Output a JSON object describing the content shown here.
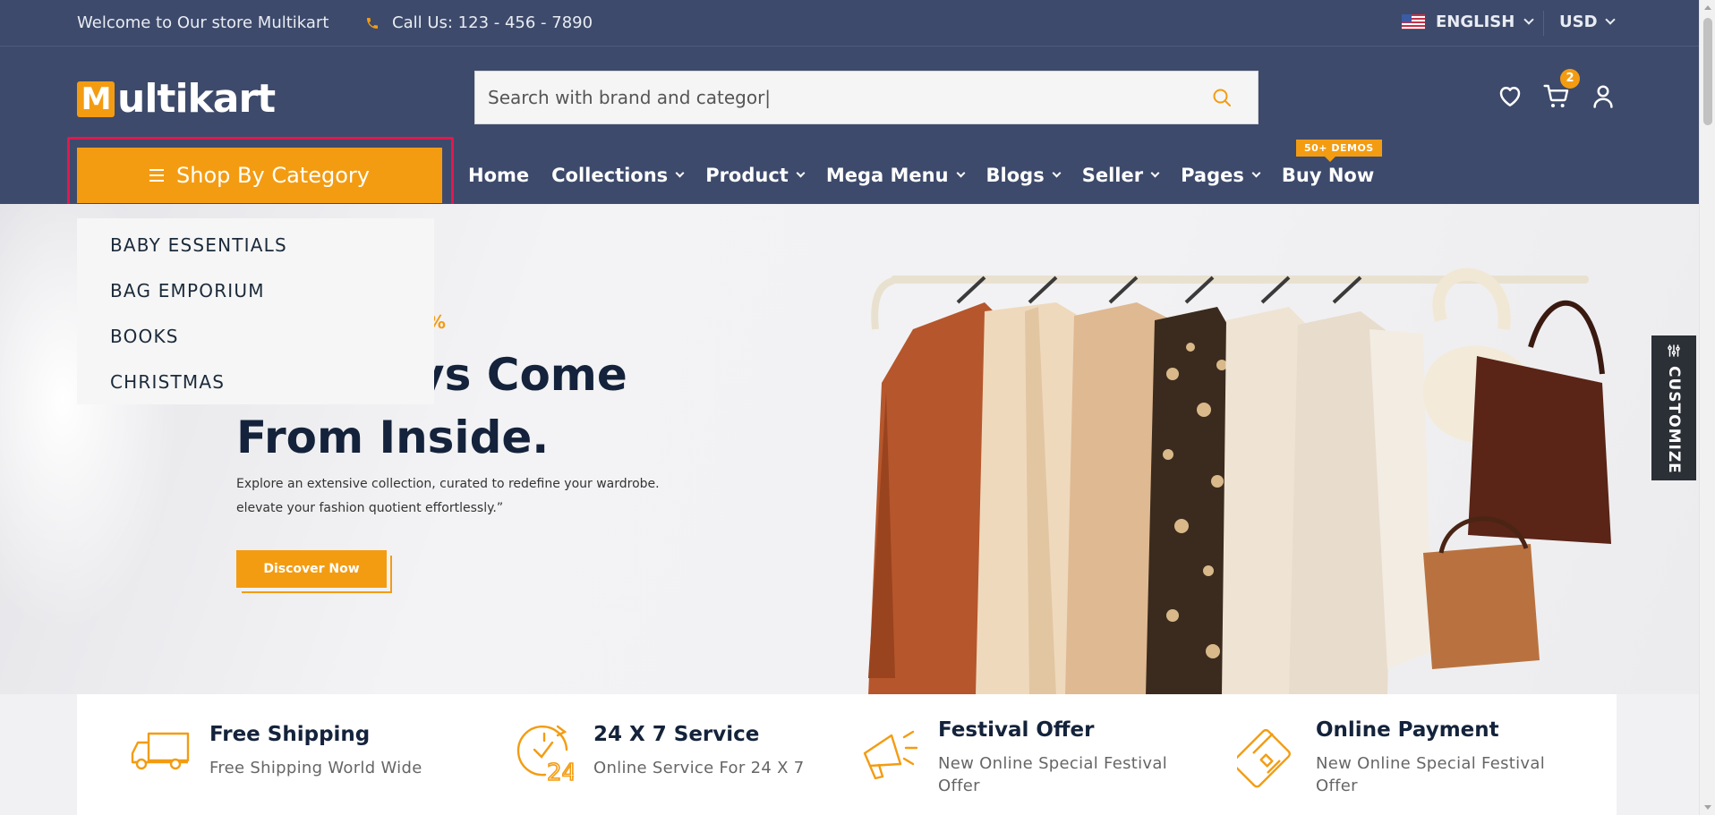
{
  "topbar": {
    "welcome": "Welcome to Our store Multikart",
    "call": "Call Us: 123 - 456 - 7890",
    "language": "ENGLISH",
    "currency": "USD"
  },
  "header": {
    "logo_text": "ultikart",
    "logo_letter": "M",
    "search_placeholder": "Search with brand and categor|",
    "cart_count": "2"
  },
  "nav": {
    "shop_by_category": "Shop By Category",
    "items": [
      "Home",
      "Collections",
      "Product",
      "Mega Menu",
      "Blogs",
      "Seller",
      "Pages",
      "Buy Now"
    ],
    "demos_badge": "50+ DEMOS"
  },
  "category_dropdown": {
    "items": [
      "BABY ESSENTIALS",
      "BAG EMPORIUM",
      "BOOKS",
      "CHRISTMAS"
    ]
  },
  "hero": {
    "discount_fragment": "0%",
    "heading": "Is Always Come From Inside.",
    "heading_line1": "Is Always Come",
    "heading_line2": "From Inside.",
    "description_line1": "Explore an extensive collection, curated to redefine your wardrobe.",
    "description_line2": "elevate your fashion quotient effortlessly.”",
    "cta": "Discover Now"
  },
  "customize_tab": "CUSTOMIZE",
  "features": [
    {
      "title": "Free Shipping",
      "subtitle": "Free Shipping World Wide",
      "icon": "truck-icon"
    },
    {
      "title": "24 X 7 Service",
      "subtitle": "Online Service For 24 X 7",
      "icon": "clock-24-icon"
    },
    {
      "title": "Festival Offer",
      "subtitle": "New Online Special Festival Offer",
      "icon": "megaphone-icon"
    },
    {
      "title": "Online Payment",
      "subtitle": "New Online Special Festival Offer",
      "icon": "credit-card-icon"
    }
  ],
  "colors": {
    "header_bg": "#3d4a6b",
    "accent": "#f39c12",
    "highlight_border": "#e3174f",
    "heading": "#14233b"
  }
}
